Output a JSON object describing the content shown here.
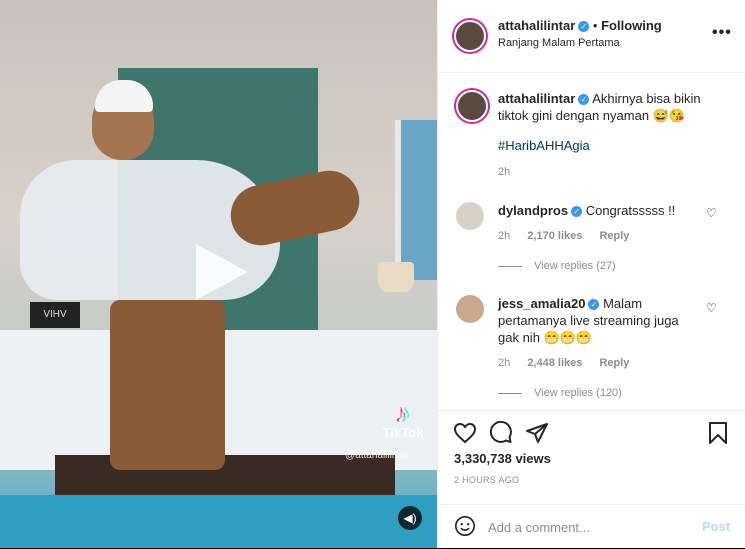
{
  "media": {
    "tiktok_label": "TikTok",
    "tiktok_handle": "@attahalilintar",
    "clock_text": "VIHV"
  },
  "post": {
    "author": "attahalilintar",
    "follow_status": "Following",
    "location": "Ranjang Malam Pertama",
    "caption": "Akhirnya bisa bikin tiktok gini dengan nyaman 😅😘",
    "hashtag": "#HaribAHHAgia",
    "caption_time": "2h",
    "views": "3,330,738 views",
    "posted": "2 HOURS AGO"
  },
  "comments": [
    {
      "user": "dylandpros",
      "text": "Congratsssss !!",
      "time": "2h",
      "likes": "2,170 likes",
      "reply": "Reply",
      "view_replies": "View replies (27)"
    },
    {
      "user": "jess_amalia20",
      "text": "Malam pertamanya live streaming juga gak nih 😁😁😁",
      "time": "2h",
      "likes": "2,448 likes",
      "reply": "Reply",
      "view_replies": "View replies (120)"
    }
  ],
  "add_comment": {
    "placeholder": "Add a comment...",
    "post_label": "Post"
  },
  "icons": {
    "like": "heart-icon",
    "comment": "comment-icon",
    "share": "paper-plane-icon",
    "save": "bookmark-icon",
    "more": "more-icon",
    "emoji": "smiley-icon",
    "sound": "speaker-icon",
    "verified": "verified-badge-icon"
  },
  "colors": {
    "verified": "#3897f0",
    "post_button": "#b2dffc",
    "hashtag": "#00376b",
    "text_primary": "#262626",
    "text_secondary": "#8e8e8e"
  }
}
